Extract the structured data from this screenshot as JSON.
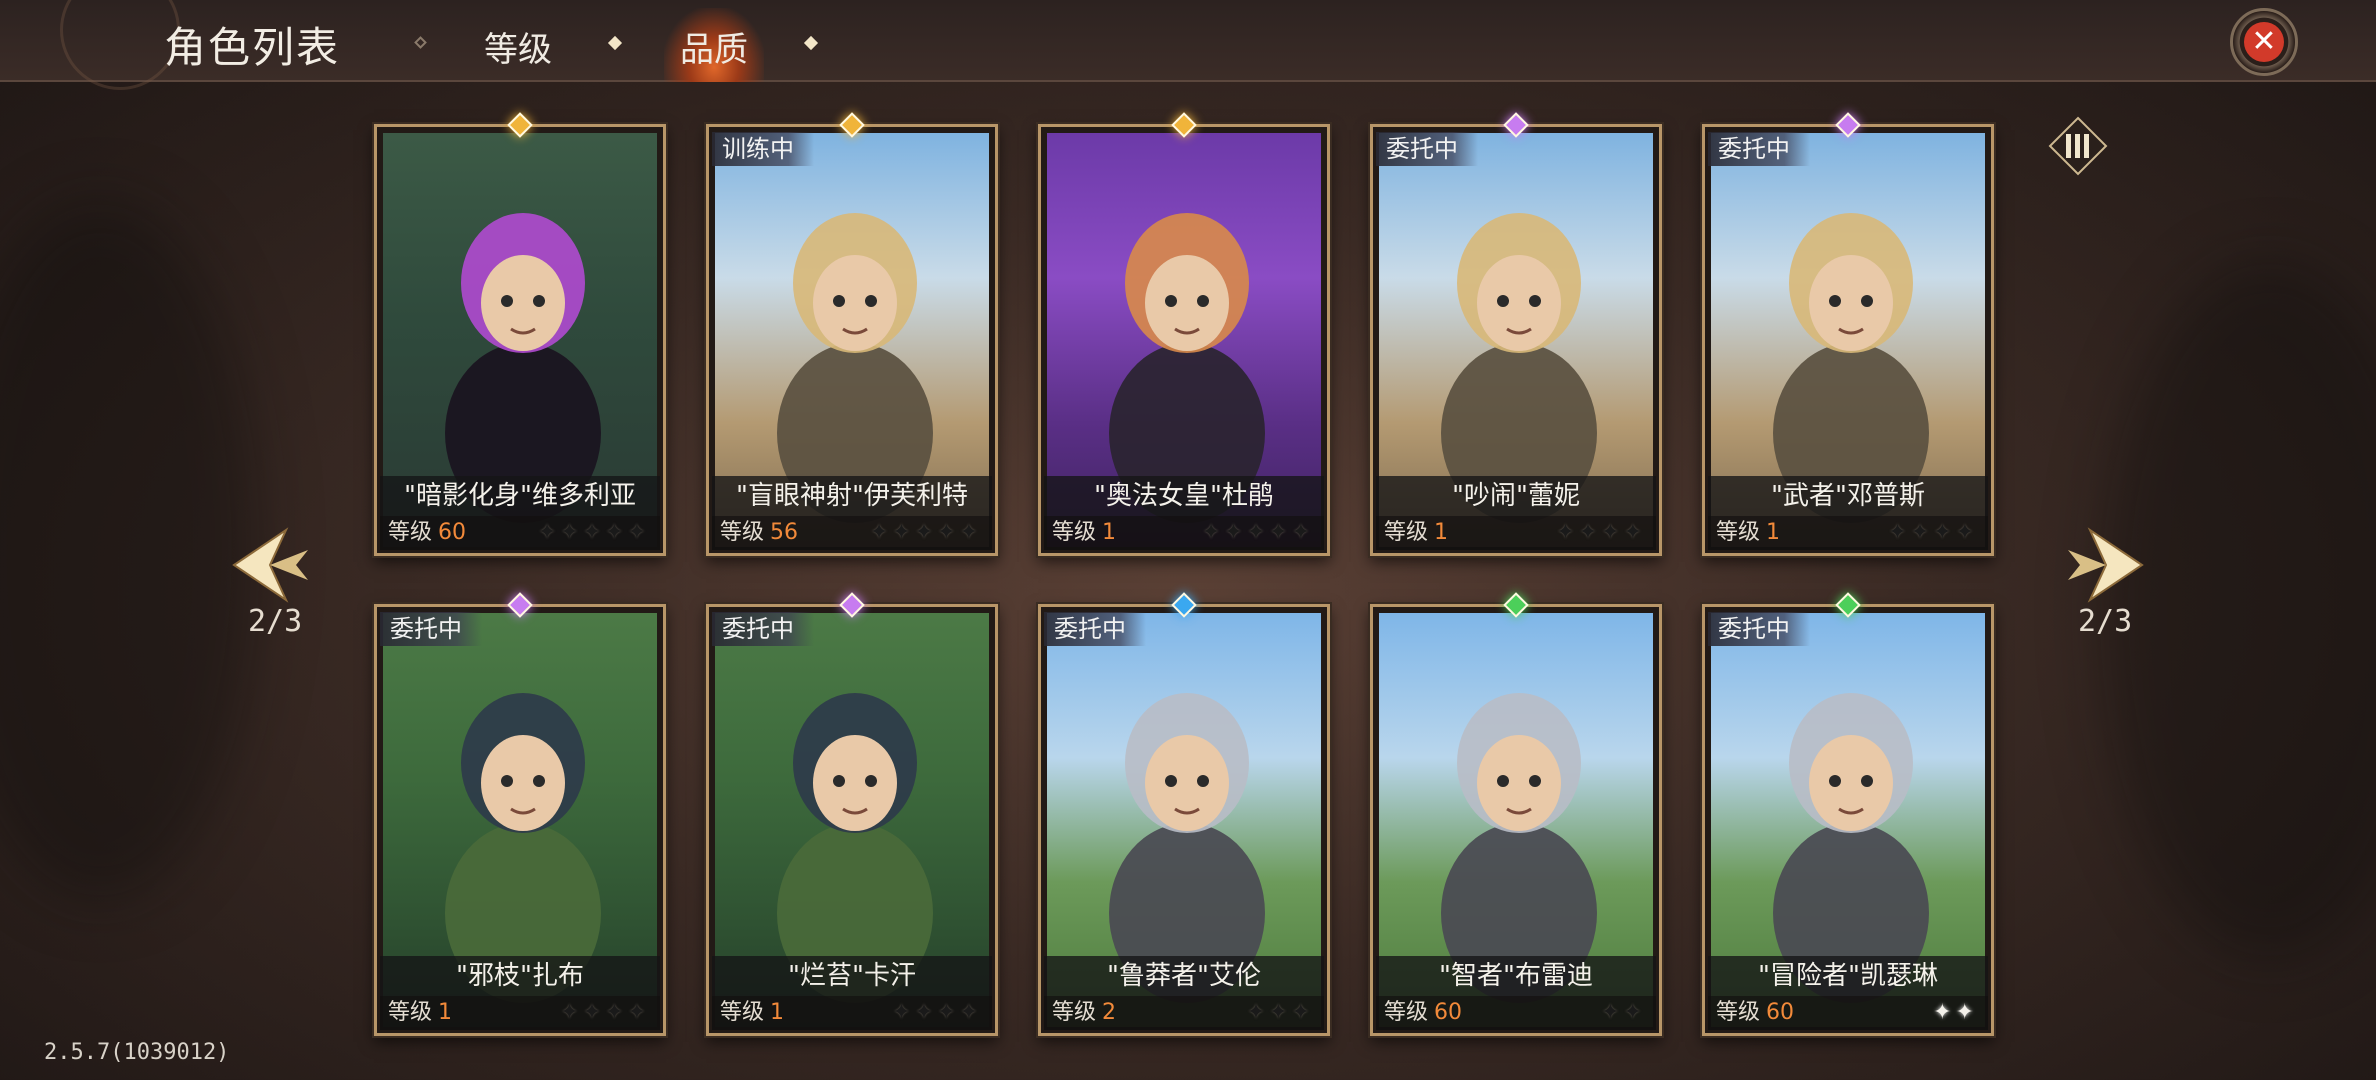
{
  "header": {
    "title": "角色列表",
    "tabs": [
      {
        "label": "等级"
      },
      {
        "label": "品质"
      }
    ]
  },
  "pagination": {
    "left": "2/3",
    "right": "2/3"
  },
  "level_label": "等级",
  "version": "2.5.7(1039012)",
  "colors": {
    "gold": "#f0b43a",
    "purple": "#c77cf0",
    "blue": "#3aa8f0",
    "green": "#4ccf5a",
    "level_number": "#f28a3a",
    "close_red": "#d23a2a"
  },
  "cards": [
    {
      "name": "\"暗影化身\"维多利亚",
      "level": "60",
      "status": "",
      "gem": "gold",
      "stars_total": 5,
      "stars_lit": 0,
      "scene": "forest-dark"
    },
    {
      "name": "\"盲眼神射\"伊芙利特",
      "level": "56",
      "status": "训练中",
      "gem": "gold",
      "stars_total": 5,
      "stars_lit": 0,
      "scene": "canyon"
    },
    {
      "name": "\"奥法女皇\"杜鹃",
      "level": "1",
      "status": "",
      "gem": "gold",
      "stars_total": 5,
      "stars_lit": 0,
      "scene": "arcane"
    },
    {
      "name": "\"吵闹\"蕾妮",
      "level": "1",
      "status": "委托中",
      "gem": "purple",
      "stars_total": 4,
      "stars_lit": 0,
      "scene": "canyon"
    },
    {
      "name": "\"武者\"邓普斯",
      "level": "1",
      "status": "委托中",
      "gem": "purple",
      "stars_total": 4,
      "stars_lit": 0,
      "scene": "canyon"
    },
    {
      "name": "\"邪枝\"扎布",
      "level": "1",
      "status": "委托中",
      "gem": "purple",
      "stars_total": 4,
      "stars_lit": 0,
      "scene": "jungle"
    },
    {
      "name": "\"烂苔\"卡汗",
      "level": "1",
      "status": "委托中",
      "gem": "purple",
      "stars_total": 4,
      "stars_lit": 0,
      "scene": "jungle"
    },
    {
      "name": "\"鲁莽者\"艾伦",
      "level": "2",
      "status": "委托中",
      "gem": "blue",
      "stars_total": 3,
      "stars_lit": 0,
      "scene": "meadow"
    },
    {
      "name": "\"智者\"布雷迪",
      "level": "60",
      "status": "",
      "gem": "green",
      "stars_total": 2,
      "stars_lit": 0,
      "scene": "meadow"
    },
    {
      "name": "\"冒险者\"凯瑟琳",
      "level": "60",
      "status": "委托中",
      "gem": "green",
      "stars_total": 2,
      "stars_lit": 2,
      "scene": "meadow"
    }
  ]
}
